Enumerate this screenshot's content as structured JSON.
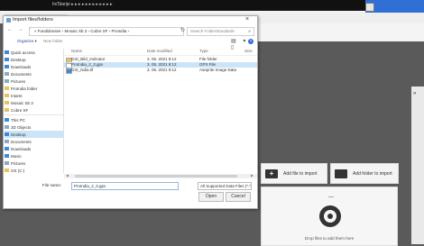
{
  "window": {
    "title": "In/Stanje ▸ ▸ ▸ ▸ ▸ ▸ ▸ ▸ ▸ ▸ ▸ ▸"
  },
  "dialog": {
    "title": "Import files/folders",
    "close": "×",
    "nav_arrows": "← → ↑",
    "address": "« Fundidossier › Mosaic Sb 3 › Cobre SF › ProIndia ›",
    "search_placeholder": "Search FolderStandards",
    "search_icon": "magnifier-icon",
    "organize": "Organize ▾",
    "new_folder": "New folder",
    "view_icons": "▤ ▾ ▯",
    "help": "?",
    "sidebar": [
      {
        "label": "Quick access",
        "icon": "star-icon",
        "color": "#3b8ad9"
      },
      {
        "label": "Desktop",
        "icon": "desktop-icon",
        "color": "#3b8ad9"
      },
      {
        "label": "Downloads",
        "icon": "download-icon",
        "color": "#3b8ad9"
      },
      {
        "label": "Documents",
        "icon": "document-icon",
        "color": "#8aa9c8"
      },
      {
        "label": "Pictures",
        "icon": "picture-icon",
        "color": "#8aa9c8"
      },
      {
        "label": "ProIndia folder",
        "icon": "folder-icon",
        "color": "#e8c35a"
      },
      {
        "label": "Intamt",
        "icon": "folder-icon",
        "color": "#e8c35a"
      },
      {
        "label": "Mosaic Sb 3",
        "icon": "folder-icon",
        "color": "#e8c35a"
      },
      {
        "label": "Cobre SF",
        "icon": "folder-icon",
        "color": "#e8c35a"
      },
      {
        "label": "This PC",
        "icon": "pc-icon",
        "color": "#3b8ad9"
      },
      {
        "label": "3D Objects",
        "icon": "cube-icon",
        "color": "#8aa9c8"
      },
      {
        "label": "Desktop",
        "icon": "desktop-icon",
        "color": "#3b8ad9",
        "selected": true
      },
      {
        "label": "Documents",
        "icon": "document-icon",
        "color": "#8aa9c8"
      },
      {
        "label": "Downloads",
        "icon": "download-icon",
        "color": "#3b8ad9"
      },
      {
        "label": "Music",
        "icon": "music-icon",
        "color": "#3b8ad9"
      },
      {
        "label": "Pictures",
        "icon": "picture-icon",
        "color": "#8aa9c8"
      },
      {
        "label": "OS (C:)",
        "icon": "drive-icon",
        "color": "#e8c35a"
      }
    ],
    "columns": {
      "name": "Name",
      "date": "Date modified",
      "type": "Type",
      "size": "Size"
    },
    "files": [
      {
        "name": "GIS_Bild_Indicator",
        "date": "3. 05. 2021 9:12",
        "type": "File folder",
        "icon": "folder-icon",
        "color": "#e8c35a"
      },
      {
        "name": "ProIndia_2_3.gpx",
        "date": "3. 05. 2021 9:12",
        "type": "GPX File",
        "icon": "file-icon",
        "color": "#ffffff",
        "selected": true
      },
      {
        "name": "GIS_Ndia.tif",
        "date": "3. 05. 2021 9:12",
        "type": "Aseprite Image Data",
        "icon": "image-file-icon",
        "color": "#3b8ad9"
      }
    ],
    "filename_label": "File name:",
    "filename_value": "ProIndia_2_3.gpx",
    "filetype_value": "All Supported Data Files (*.*)",
    "open_label": "Open",
    "cancel_label": "Cancel"
  },
  "panel": {
    "add_file_label": "Add file to import",
    "add_folder_label": "Add folder to import",
    "drop_text": "Drop files to add them here",
    "strip_text": "»"
  }
}
